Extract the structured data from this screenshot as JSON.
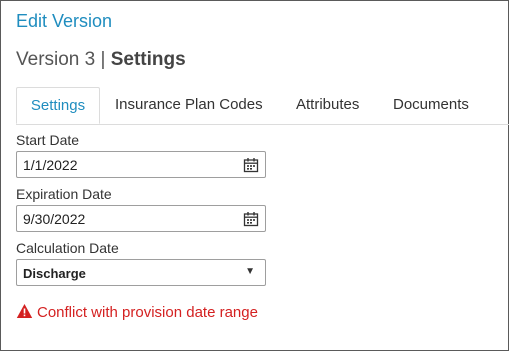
{
  "dialog": {
    "title": "Edit Version"
  },
  "header": {
    "version": "Version 3",
    "separator": "|",
    "section": "Settings"
  },
  "tabs": [
    {
      "label": "Settings",
      "active": true
    },
    {
      "label": "Insurance Plan Codes",
      "active": false
    },
    {
      "label": "Attributes",
      "active": false
    },
    {
      "label": "Documents",
      "active": false
    }
  ],
  "form": {
    "start_date": {
      "label": "Start Date",
      "value": "1/1/2022",
      "icon": "calendar-icon"
    },
    "expiration_date": {
      "label": "Expiration Date",
      "value": "9/30/2022",
      "icon": "calendar-icon"
    },
    "calculation_date": {
      "label": "Calculation Date",
      "value": "Discharge",
      "icon": "caret-down-icon"
    }
  },
  "error": {
    "message": "Conflict with provision date range",
    "icon": "warning-icon",
    "color": "#d42121"
  },
  "colors": {
    "accent": "#1f8dbf",
    "error": "#d42121"
  }
}
